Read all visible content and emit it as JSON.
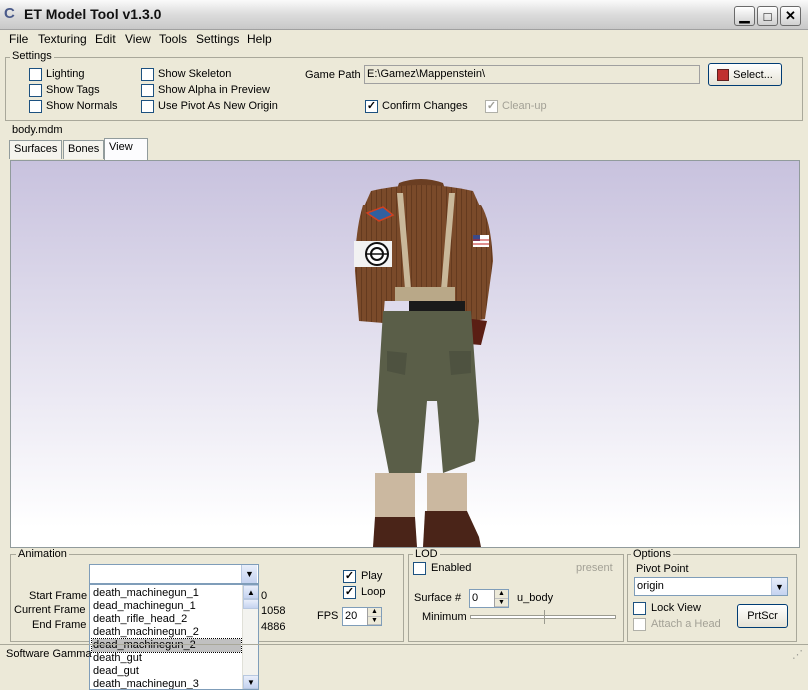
{
  "window": {
    "title": "ET Model Tool v1.3.0",
    "min": "▁",
    "max": "□",
    "close": "✕"
  },
  "menu": [
    "File",
    "Texturing",
    "Edit",
    "View",
    "Tools",
    "Settings",
    "Help"
  ],
  "settings": {
    "title": "Settings",
    "lighting": "Lighting",
    "show_tags": "Show Tags",
    "show_normals": "Show Normals",
    "show_skeleton": "Show Skeleton",
    "show_alpha": "Show Alpha in Preview",
    "use_pivot": "Use Pivot As New Origin",
    "game_path_label": "Game Path",
    "game_path_value": "E:\\Gamez\\Mappenstein\\",
    "select_button": "Select...",
    "confirm_changes": "Confirm Changes",
    "cleanup": "Clean-up"
  },
  "model_name": "body.mdm",
  "tabs": [
    "Surfaces",
    "Bones",
    "View"
  ],
  "animation": {
    "title": "Animation",
    "start_frame_label": "Start Frame",
    "current_frame_label": "Current Frame",
    "end_frame_label": "End Frame",
    "start_frame_value": "0",
    "current_frame_value": "1058",
    "end_frame_value": "4886",
    "play": "Play",
    "loop": "Loop",
    "fps_label": "FPS",
    "fps_value": "20",
    "list": [
      "death_machinegun_1",
      "dead_machinegun_1",
      "death_rifle_head_2",
      "death_machinegun_2",
      "dead_machinegun_2",
      "death_gut",
      "dead_gut",
      "death_machinegun_3"
    ]
  },
  "lod": {
    "title": "LOD",
    "enabled": "Enabled",
    "present": "present",
    "surface_label": "Surface #",
    "surface_value": "0",
    "surface_name": "u_body",
    "minimum_label": "Minimum"
  },
  "options": {
    "title": "Options",
    "pivot_point_label": "Pivot Point",
    "pivot_value": "origin",
    "lock_view": "Lock View",
    "attach_head": "Attach a Head",
    "prtscr": "PrtScr"
  },
  "status": {
    "text": "Software Gamma"
  },
  "colors": {
    "jacket": "#7a4a2a",
    "pants": "#5a5e48",
    "boots": "#4a2418",
    "viewport_top": "#c8c2de"
  }
}
